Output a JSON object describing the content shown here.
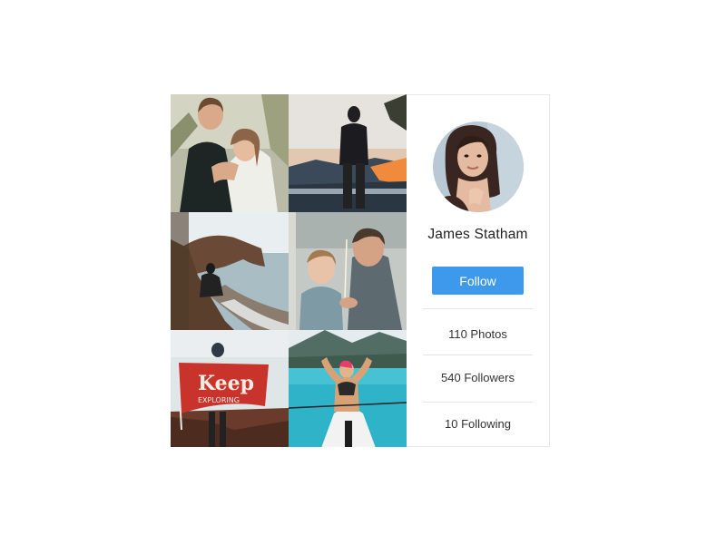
{
  "photos": [
    {
      "subject": "couple embracing outdoors"
    },
    {
      "subject": "man standing facing mountain sunset"
    },
    {
      "subject": "person sitting on coastal cliff"
    },
    {
      "subject": "father and child with sparkler"
    },
    {
      "subject": "person holding flag",
      "flag_text": [
        "Keep",
        "EXPLORING"
      ]
    },
    {
      "subject": "person in kayak on turquoise lake"
    }
  ],
  "profile": {
    "name": "James Statham",
    "follow_label": "Follow",
    "stats": {
      "photos": "110 Photos",
      "followers": "540 Followers",
      "following": "10 Following"
    }
  },
  "colors": {
    "accent": "#3d99ec",
    "border": "#e8e8e8",
    "divider": "#e3e3e3",
    "flag": "#c8342b"
  }
}
